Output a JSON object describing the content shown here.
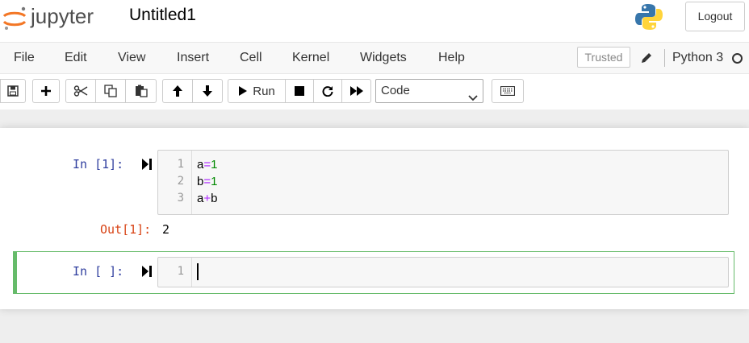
{
  "header": {
    "logo_text": "jupyter",
    "notebook_name": "Untitled1",
    "logout_label": "Logout"
  },
  "menubar": {
    "items": [
      "File",
      "Edit",
      "View",
      "Insert",
      "Cell",
      "Kernel",
      "Widgets",
      "Help"
    ],
    "trusted_label": "Trusted",
    "kernel_name": "Python 3"
  },
  "toolbar": {
    "run_label": "Run",
    "cell_type": "Code",
    "icons": [
      "save-icon",
      "plus-icon",
      "cut-icon",
      "copy-icon",
      "paste-icon",
      "arrow-up-icon",
      "arrow-down-icon",
      "play-icon",
      "stop-icon",
      "restart-icon",
      "fast-forward-icon",
      "keyboard-icon"
    ]
  },
  "cells": [
    {
      "in_prompt": "In [1]:",
      "lines": [
        {
          "num": "1",
          "code": "a=1"
        },
        {
          "num": "2",
          "code": "b=1"
        },
        {
          "num": "3",
          "code": "a+b"
        }
      ],
      "out_prompt": "Out[1]:",
      "output": "2"
    },
    {
      "in_prompt": "In [ ]:",
      "lines": [
        {
          "num": "1",
          "code": ""
        }
      ]
    }
  ],
  "colors": {
    "in_prompt": "#303f9f",
    "out_prompt": "#d84315",
    "selected_border": "#66bb6a",
    "logo_orange": "#f37726"
  }
}
